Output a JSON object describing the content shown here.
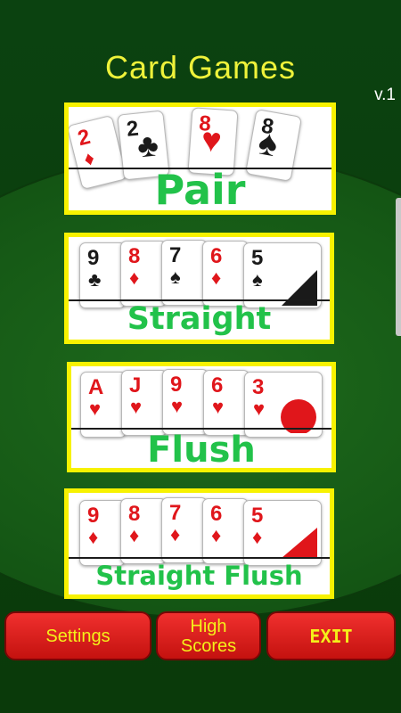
{
  "app": {
    "title": "Card Games",
    "version": "v.1"
  },
  "games": [
    {
      "label": "Pair",
      "cards": [
        {
          "rank": "2",
          "suit": "♦",
          "color": "red"
        },
        {
          "rank": "2",
          "suit": "♣",
          "color": "black"
        },
        {
          "rank": "8",
          "suit": "♥",
          "color": "red"
        },
        {
          "rank": "8",
          "suit": "♠",
          "color": "black"
        }
      ]
    },
    {
      "label": "Straight",
      "cards": [
        {
          "rank": "9",
          "suit": "♣",
          "color": "black"
        },
        {
          "rank": "8",
          "suit": "♦",
          "color": "red"
        },
        {
          "rank": "7",
          "suit": "♠",
          "color": "black"
        },
        {
          "rank": "6",
          "suit": "♦",
          "color": "red"
        },
        {
          "rank": "5",
          "suit": "♠",
          "color": "black"
        }
      ]
    },
    {
      "label": "Flush",
      "cards": [
        {
          "rank": "A",
          "suit": "♥",
          "color": "red"
        },
        {
          "rank": "J",
          "suit": "♥",
          "color": "red"
        },
        {
          "rank": "9",
          "suit": "♥",
          "color": "red"
        },
        {
          "rank": "6",
          "suit": "♥",
          "color": "red"
        },
        {
          "rank": "3",
          "suit": "♥",
          "color": "red"
        }
      ]
    },
    {
      "label": "Straight Flush",
      "cards": [
        {
          "rank": "9",
          "suit": "♦",
          "color": "red"
        },
        {
          "rank": "8",
          "suit": "♦",
          "color": "red"
        },
        {
          "rank": "7",
          "suit": "♦",
          "color": "red"
        },
        {
          "rank": "6",
          "suit": "♦",
          "color": "red"
        },
        {
          "rank": "5",
          "suit": "♦",
          "color": "red"
        }
      ]
    }
  ],
  "buttons": {
    "settings": "Settings",
    "high_scores_line1": "High",
    "high_scores_line2": "Scores",
    "exit": "EXIT"
  },
  "colors": {
    "title": "#eef23a",
    "panel_border": "#f7f200",
    "label_green": "#22c24a",
    "button_red": "#e0201e",
    "button_text": "#f4f01a",
    "card_red": "#e0161b",
    "felt": "#1e6a1c"
  }
}
